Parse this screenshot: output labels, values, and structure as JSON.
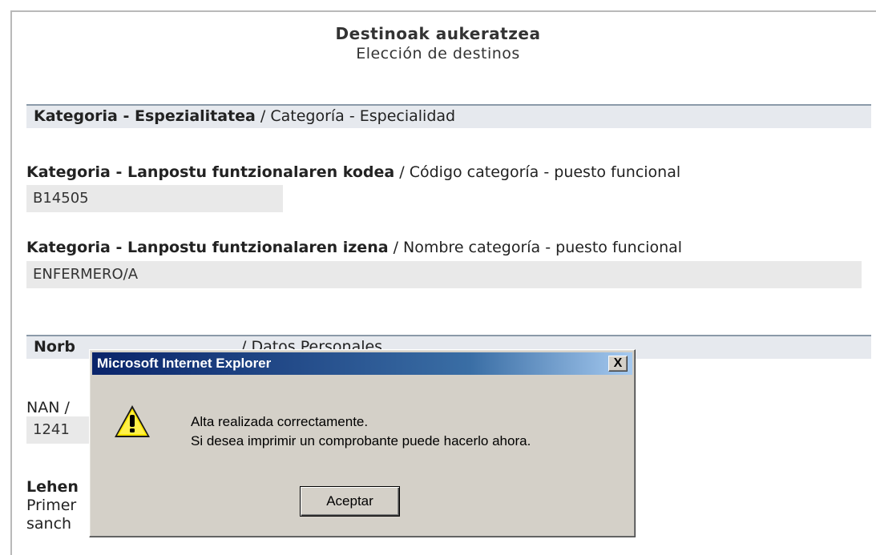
{
  "page": {
    "title_eu": "Destinoak aukeratzea",
    "title_es": "Elección de destinos"
  },
  "section_category": {
    "label_eu": "Kategoria - Espezialitatea",
    "label_es": " / Categoría - Especialidad"
  },
  "field_code": {
    "label_eu": "Kategoria - Lanpostu funtzionalaren kodea",
    "label_es": " / Código categoría - puesto funcional",
    "value": "B14505"
  },
  "field_name": {
    "label_eu": "Kategoria - Lanpostu funtzionalaren izena",
    "label_es": " / Nombre categoría - puesto funcional",
    "value": "ENFERMERO/A"
  },
  "section_personal": {
    "label_eu_partial": "Norb",
    "label_es_partial": "/ Datos Personales"
  },
  "field_nan": {
    "label_partial": "NAN /",
    "value_partial": "1241"
  },
  "field_lehen": {
    "label_partial": "Lehen",
    "line2_partial": "Primer",
    "line3_partial": "sanch"
  },
  "dialog": {
    "title": "Microsoft Internet Explorer",
    "close_label": "X",
    "message_line1": "Alta realizada correctamente.",
    "message_line2": "Si desea imprimir un comprobante puede hacerlo ahora.",
    "ok_label": "Aceptar",
    "icon": "warning-icon"
  },
  "colors": {
    "titlebar_start": "#0a246a",
    "titlebar_end": "#a6caf0",
    "section_bg": "#e6e9ee",
    "value_bg": "#e9e9e9",
    "dialog_bg": "#d4d0c8"
  }
}
